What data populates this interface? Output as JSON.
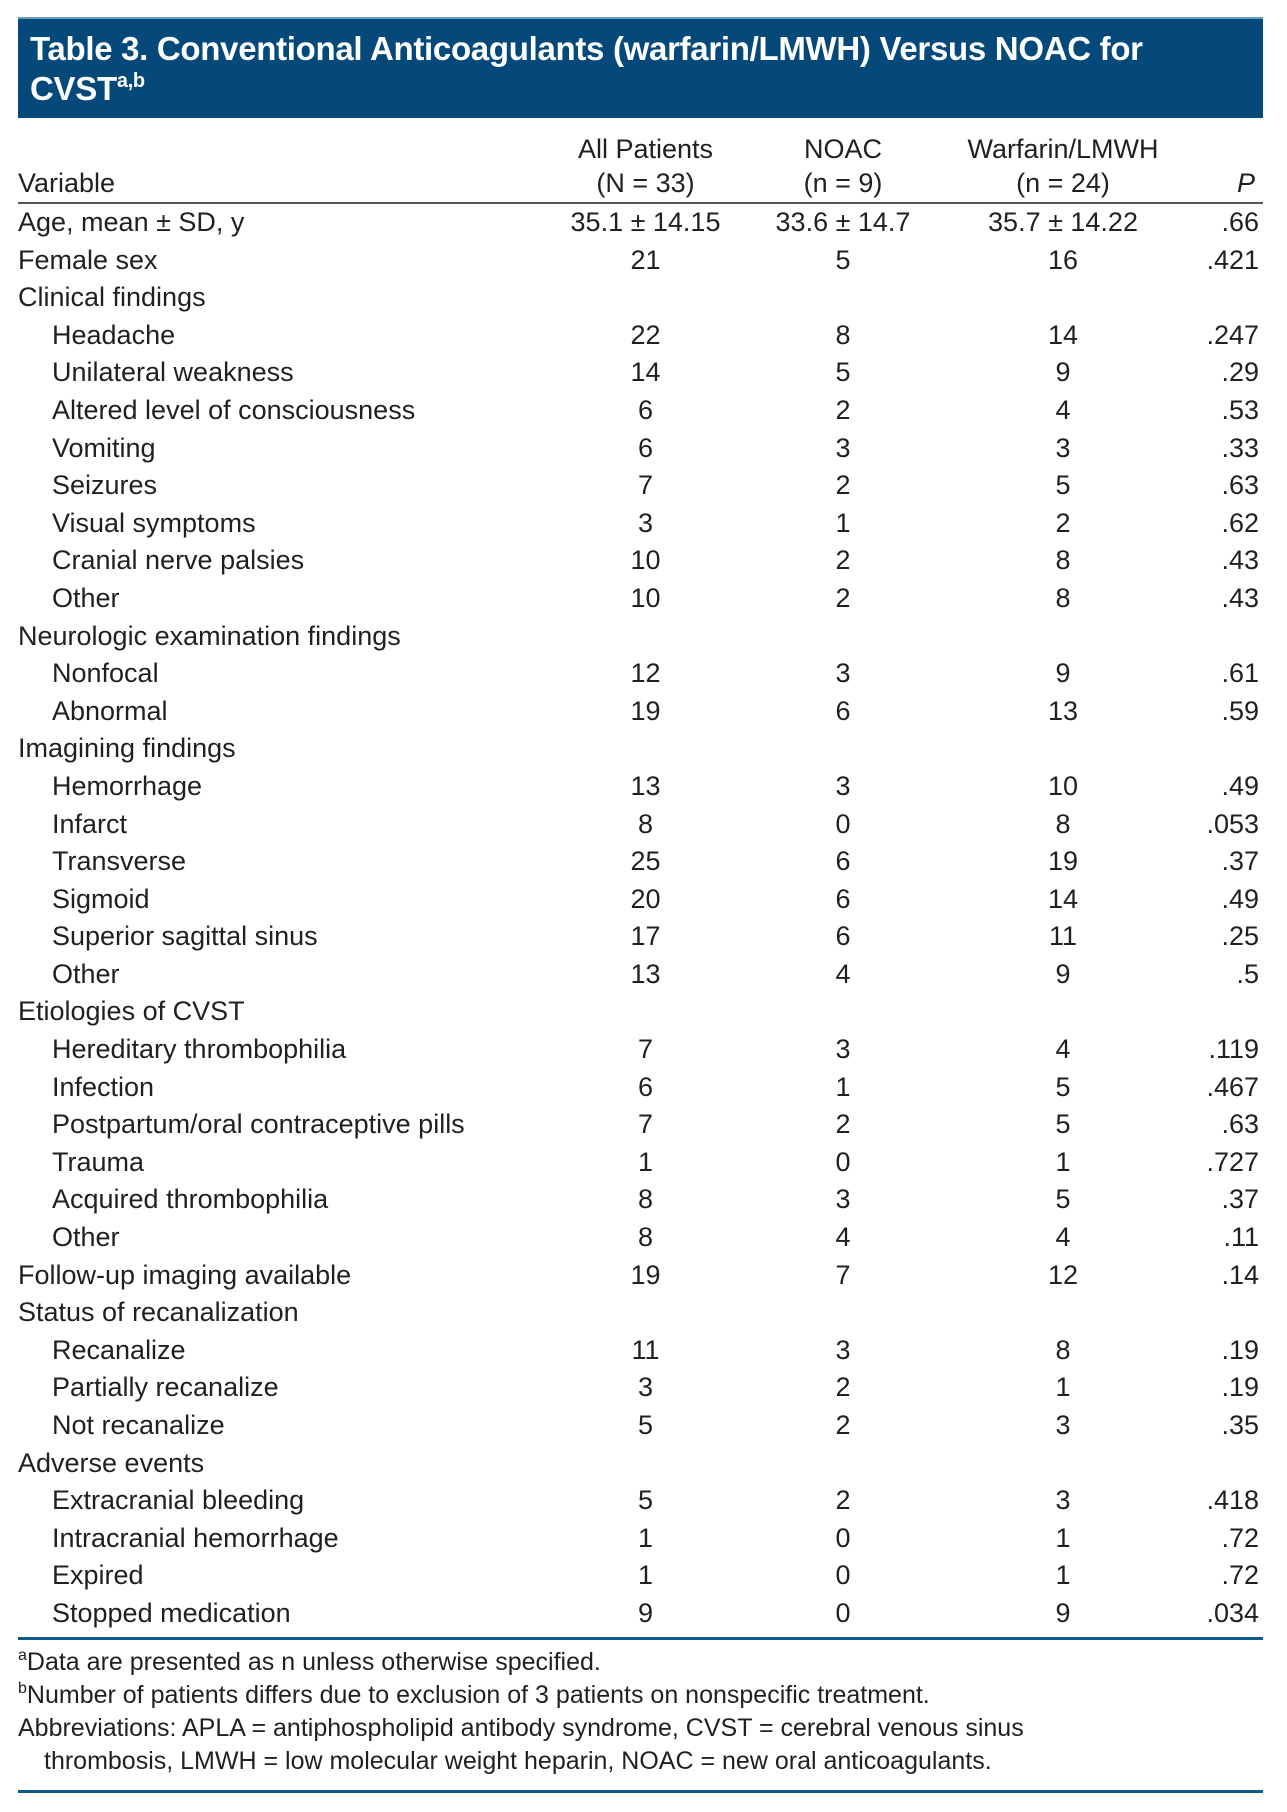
{
  "title": {
    "text": "Table 3. Conventional Anticoagulants (warfarin/LMWH) Versus NOAC for CVST",
    "superscript": "a,b"
  },
  "columns": {
    "variable": "Variable",
    "all_patients": {
      "line1": "All Patients",
      "line2": "(N = 33)"
    },
    "noac": {
      "line1": "NOAC",
      "line2": "(n = 9)"
    },
    "warfarin": {
      "line1": "Warfarin/LMWH",
      "line2": "(n = 24)"
    },
    "p": "P"
  },
  "rows": [
    {
      "label": "Age, mean ± SD, y",
      "indent": false,
      "all": "35.1 ± 14.15",
      "noac": "33.6 ± 14.7",
      "warfarin": "35.7 ± 14.22",
      "p": ".66"
    },
    {
      "label": "Female sex",
      "indent": false,
      "all": "21",
      "noac": "5",
      "warfarin": "16",
      "p": ".421"
    },
    {
      "label": "Clinical findings",
      "indent": false,
      "all": "",
      "noac": "",
      "warfarin": "",
      "p": ""
    },
    {
      "label": "Headache",
      "indent": true,
      "all": "22",
      "noac": "8",
      "warfarin": "14",
      "p": ".247"
    },
    {
      "label": "Unilateral weakness",
      "indent": true,
      "all": "14",
      "noac": "5",
      "warfarin": "9",
      "p": ".29"
    },
    {
      "label": "Altered level of consciousness",
      "indent": true,
      "all": "6",
      "noac": "2",
      "warfarin": "4",
      "p": ".53"
    },
    {
      "label": "Vomiting",
      "indent": true,
      "all": "6",
      "noac": "3",
      "warfarin": "3",
      "p": ".33"
    },
    {
      "label": "Seizures",
      "indent": true,
      "all": "7",
      "noac": "2",
      "warfarin": "5",
      "p": ".63"
    },
    {
      "label": "Visual symptoms",
      "indent": true,
      "all": "3",
      "noac": "1",
      "warfarin": "2",
      "p": ".62"
    },
    {
      "label": "Cranial nerve palsies",
      "indent": true,
      "all": "10",
      "noac": "2",
      "warfarin": "8",
      "p": ".43"
    },
    {
      "label": "Other",
      "indent": true,
      "all": "10",
      "noac": "2",
      "warfarin": "8",
      "p": ".43"
    },
    {
      "label": "Neurologic examination findings",
      "indent": false,
      "all": "",
      "noac": "",
      "warfarin": "",
      "p": ""
    },
    {
      "label": "Nonfocal",
      "indent": true,
      "all": "12",
      "noac": "3",
      "warfarin": "9",
      "p": ".61"
    },
    {
      "label": "Abnormal",
      "indent": true,
      "all": "19",
      "noac": "6",
      "warfarin": "13",
      "p": ".59"
    },
    {
      "label": "Imagining findings",
      "indent": false,
      "all": "",
      "noac": "",
      "warfarin": "",
      "p": ""
    },
    {
      "label": "Hemorrhage",
      "indent": true,
      "all": "13",
      "noac": "3",
      "warfarin": "10",
      "p": ".49"
    },
    {
      "label": "Infarct",
      "indent": true,
      "all": "8",
      "noac": "0",
      "warfarin": "8",
      "p": ".053"
    },
    {
      "label": "Transverse",
      "indent": true,
      "all": "25",
      "noac": "6",
      "warfarin": "19",
      "p": ".37"
    },
    {
      "label": "Sigmoid",
      "indent": true,
      "all": "20",
      "noac": "6",
      "warfarin": "14",
      "p": ".49"
    },
    {
      "label": "Superior sagittal sinus",
      "indent": true,
      "all": "17",
      "noac": "6",
      "warfarin": "11",
      "p": ".25"
    },
    {
      "label": "Other",
      "indent": true,
      "all": "13",
      "noac": "4",
      "warfarin": "9",
      "p": ".5"
    },
    {
      "label": "Etiologies of CVST",
      "indent": false,
      "all": "",
      "noac": "",
      "warfarin": "",
      "p": ""
    },
    {
      "label": "Hereditary thrombophilia",
      "indent": true,
      "all": "7",
      "noac": "3",
      "warfarin": "4",
      "p": ".119"
    },
    {
      "label": "Infection",
      "indent": true,
      "all": "6",
      "noac": "1",
      "warfarin": "5",
      "p": ".467"
    },
    {
      "label": "Postpartum/oral contraceptive pills",
      "indent": true,
      "all": "7",
      "noac": "2",
      "warfarin": "5",
      "p": ".63"
    },
    {
      "label": "Trauma",
      "indent": true,
      "all": "1",
      "noac": "0",
      "warfarin": "1",
      "p": ".727"
    },
    {
      "label": "Acquired thrombophilia",
      "indent": true,
      "all": "8",
      "noac": "3",
      "warfarin": "5",
      "p": ".37"
    },
    {
      "label": "Other",
      "indent": true,
      "all": "8",
      "noac": "4",
      "warfarin": "4",
      "p": ".11"
    },
    {
      "label": "Follow-up imaging available",
      "indent": false,
      "all": "19",
      "noac": "7",
      "warfarin": "12",
      "p": ".14"
    },
    {
      "label": "Status of recanalization",
      "indent": false,
      "all": "",
      "noac": "",
      "warfarin": "",
      "p": ""
    },
    {
      "label": "Recanalize",
      "indent": true,
      "all": "11",
      "noac": "3",
      "warfarin": "8",
      "p": ".19"
    },
    {
      "label": "Partially recanalize",
      "indent": true,
      "all": "3",
      "noac": "2",
      "warfarin": "1",
      "p": ".19"
    },
    {
      "label": "Not recanalize",
      "indent": true,
      "all": "5",
      "noac": "2",
      "warfarin": "3",
      "p": ".35"
    },
    {
      "label": "Adverse events",
      "indent": false,
      "all": "",
      "noac": "",
      "warfarin": "",
      "p": ""
    },
    {
      "label": "Extracranial bleeding",
      "indent": true,
      "all": "5",
      "noac": "2",
      "warfarin": "3",
      "p": ".418"
    },
    {
      "label": "Intracranial hemorrhage",
      "indent": true,
      "all": "1",
      "noac": "0",
      "warfarin": "1",
      "p": ".72"
    },
    {
      "label": "Expired",
      "indent": true,
      "all": "1",
      "noac": "0",
      "warfarin": "1",
      "p": ".72"
    },
    {
      "label": "Stopped medication",
      "indent": true,
      "all": "9",
      "noac": "0",
      "warfarin": "9",
      "p": ".034"
    }
  ],
  "footnotes": {
    "a": {
      "mark": "a",
      "text": "Data are presented as n unless otherwise specified."
    },
    "b": {
      "mark": "b",
      "text": "Number of patients differs due to exclusion of 3 patients on nonspecific treatment."
    },
    "abbreviations_line1": "Abbreviations: APLA = antiphospholipid antibody syndrome, CVST = cerebral venous sinus",
    "abbreviations_line2": "thrombosis, LMWH = low molecular weight heparin, NOAC = new oral anticoagulants."
  },
  "colors": {
    "title_band": "#04497a",
    "rule": "#0c5a8a",
    "text": "#231f20"
  }
}
